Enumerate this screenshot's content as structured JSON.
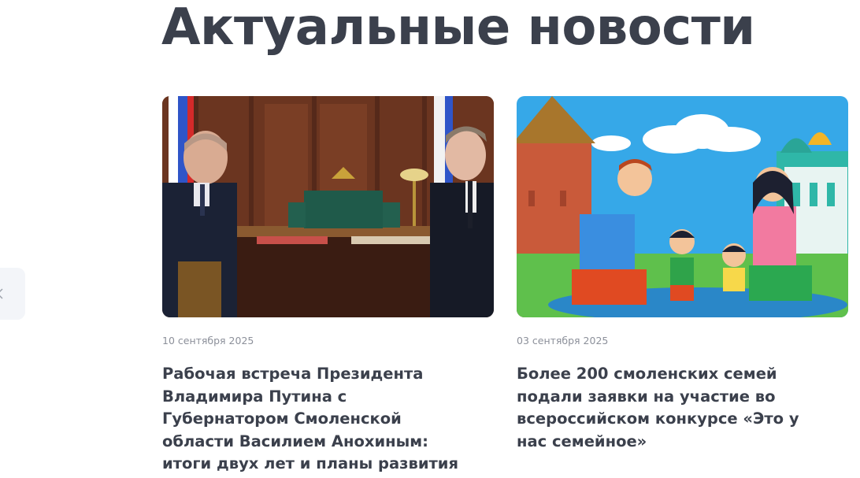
{
  "section": {
    "heading": "Актуальные новости"
  },
  "slider": {
    "prev_icon": "chevron-left-icon"
  },
  "news": [
    {
      "date": "10 сентября 2025",
      "title": "Рабочая встреча Президента Владимира Путина с Губернатором Смоленской области Василием Анохиным: итоги двух лет и планы развития"
    },
    {
      "date": "03 сентября 2025",
      "title": "Более 200 смоленских семей подали заявки на участие во всероссийском конкурсе «Это у нас семейное»"
    }
  ],
  "colors": {
    "heading": "#3b404c",
    "date": "#8c909a",
    "arrow_bg": "#f3f5f9"
  }
}
